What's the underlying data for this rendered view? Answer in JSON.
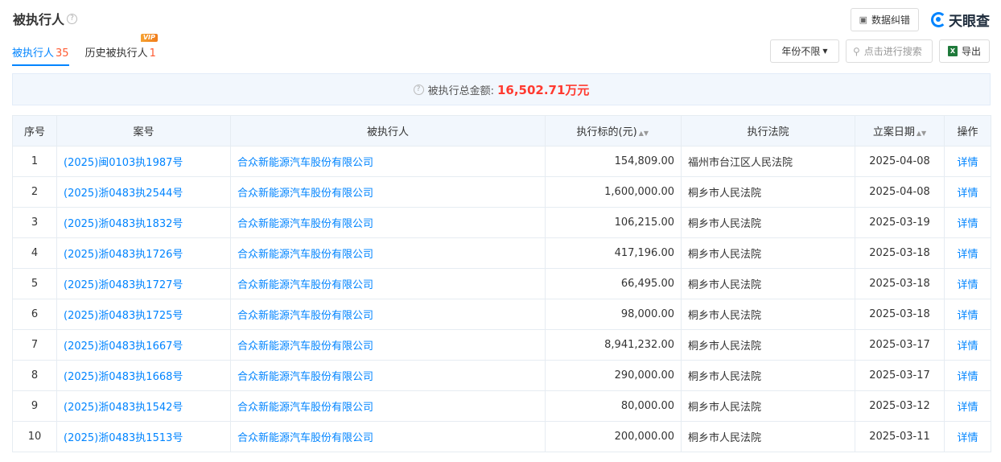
{
  "header": {
    "title": "被执行人",
    "help": "?",
    "feedback_label": "数据纠错",
    "brand": "天眼查"
  },
  "tabs": [
    {
      "label": "被执行人",
      "count": "35",
      "active": true
    },
    {
      "label": "历史被执行人",
      "count": "1",
      "badge": "VIP"
    }
  ],
  "toolbar": {
    "year_filter": "年份不限",
    "search_placeholder": "点击进行搜索",
    "export_label": "导出",
    "excel_icon": "X"
  },
  "summary": {
    "label": "被执行总金额:",
    "amount": "16,502.71万元"
  },
  "table": {
    "headers": [
      "序号",
      "案号",
      "被执行人",
      "执行标的(元)",
      "执行法院",
      "立案日期",
      "操作"
    ],
    "rows": [
      {
        "no": "1",
        "case": "(2025)闽0103执1987号",
        "party": "合众新能源汽车股份有限公司",
        "amount": "154,809.00",
        "court": "福州市台江区人民法院",
        "date": "2025-04-08",
        "action": "详情"
      },
      {
        "no": "2",
        "case": "(2025)浙0483执2544号",
        "party": "合众新能源汽车股份有限公司",
        "amount": "1,600,000.00",
        "court": "桐乡市人民法院",
        "date": "2025-04-08",
        "action": "详情"
      },
      {
        "no": "3",
        "case": "(2025)浙0483执1832号",
        "party": "合众新能源汽车股份有限公司",
        "amount": "106,215.00",
        "court": "桐乡市人民法院",
        "date": "2025-03-19",
        "action": "详情"
      },
      {
        "no": "4",
        "case": "(2025)浙0483执1726号",
        "party": "合众新能源汽车股份有限公司",
        "amount": "417,196.00",
        "court": "桐乡市人民法院",
        "date": "2025-03-18",
        "action": "详情"
      },
      {
        "no": "5",
        "case": "(2025)浙0483执1727号",
        "party": "合众新能源汽车股份有限公司",
        "amount": "66,495.00",
        "court": "桐乡市人民法院",
        "date": "2025-03-18",
        "action": "详情"
      },
      {
        "no": "6",
        "case": "(2025)浙0483执1725号",
        "party": "合众新能源汽车股份有限公司",
        "amount": "98,000.00",
        "court": "桐乡市人民法院",
        "date": "2025-03-18",
        "action": "详情"
      },
      {
        "no": "7",
        "case": "(2025)浙0483执1667号",
        "party": "合众新能源汽车股份有限公司",
        "amount": "8,941,232.00",
        "court": "桐乡市人民法院",
        "date": "2025-03-17",
        "action": "详情"
      },
      {
        "no": "8",
        "case": "(2025)浙0483执1668号",
        "party": "合众新能源汽车股份有限公司",
        "amount": "290,000.00",
        "court": "桐乡市人民法院",
        "date": "2025-03-17",
        "action": "详情"
      },
      {
        "no": "9",
        "case": "(2025)浙0483执1542号",
        "party": "合众新能源汽车股份有限公司",
        "amount": "80,000.00",
        "court": "桐乡市人民法院",
        "date": "2025-03-12",
        "action": "详情"
      },
      {
        "no": "10",
        "case": "(2025)浙0483执1513号",
        "party": "合众新能源汽车股份有限公司",
        "amount": "200,000.00",
        "court": "桐乡市人民法院",
        "date": "2025-03-11",
        "action": "详情"
      }
    ]
  }
}
